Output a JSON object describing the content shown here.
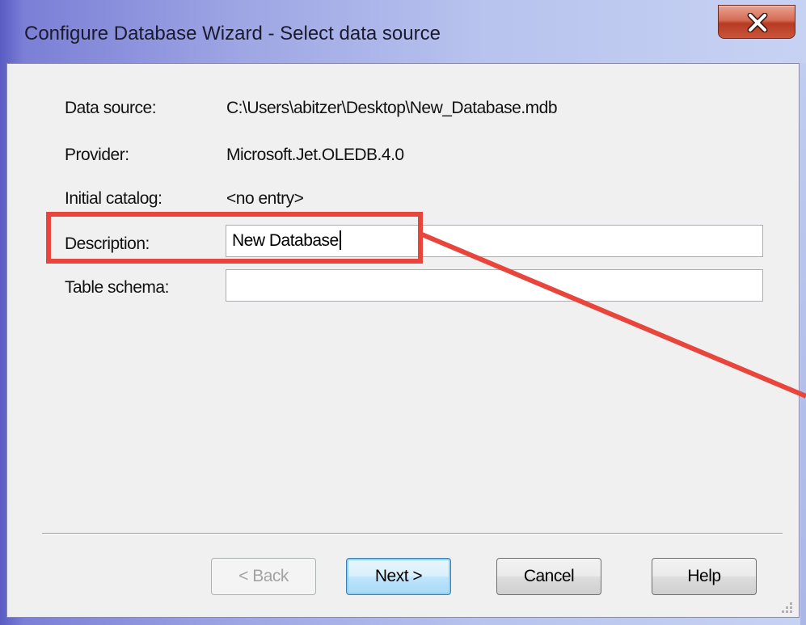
{
  "window": {
    "title": "Configure Database Wizard - Select data source",
    "close_glyph": "x"
  },
  "fields": {
    "data_source": {
      "label": "Data source:",
      "value": "C:\\Users\\abitzer\\Desktop\\New_Database.mdb"
    },
    "provider": {
      "label": "Provider:",
      "value": "Microsoft.Jet.OLEDB.4.0"
    },
    "initial_catalog": {
      "label": "Initial catalog:",
      "value": "<no entry>"
    },
    "description": {
      "label": "Description:",
      "value": "New Database"
    },
    "table_schema": {
      "label": "Table schema:",
      "value": ""
    }
  },
  "buttons": {
    "back": "< Back",
    "next": "Next >",
    "cancel": "Cancel",
    "help": "Help"
  },
  "colors": {
    "annotation": "#e8463c",
    "title_bar": "#9ea6e4",
    "close_button": "#c9553b"
  },
  "icons": {
    "close": "close-icon",
    "resize_grip": "resize-grip-icon"
  }
}
